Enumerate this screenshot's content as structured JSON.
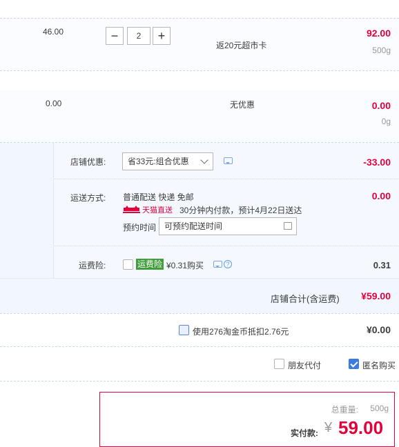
{
  "item1": {
    "unit_price": "46.00",
    "quantity": "2",
    "decrement_symbol": "−",
    "increment_symbol": "+",
    "promo": "返20元超市卡",
    "subtotal": "92.00",
    "weight": "500g"
  },
  "item2": {
    "unit_price": "0.00",
    "promo": "无优惠",
    "subtotal": "0.00",
    "weight": "0g"
  },
  "shop_discount": {
    "label": "店铺优惠:",
    "selected": "省33元:组合优惠",
    "amount": "-33.00"
  },
  "delivery": {
    "label": "运送方式:",
    "method": "普通配送 快递 免邮",
    "brand_tag": "天猫直送",
    "promise": "30分钟内付款，预计4月22日送达",
    "time_label": "预约时间",
    "time_placeholder": "可预约配送时间",
    "fee": "0.00"
  },
  "insurance": {
    "label": "运费险:",
    "tag": "运费险",
    "text": "¥0.31购买",
    "amount": "0.31",
    "help": "?"
  },
  "shop_total": {
    "label": "店铺合计(含运费)",
    "amount": "¥59.00"
  },
  "taojinbi": {
    "text": "使用276淘金币抵扣2.76元",
    "amount": "¥0.00"
  },
  "options": {
    "friend_pay": "朋友代付",
    "anonymous": "匿名购买"
  },
  "summary": {
    "weight_label": "总重量:",
    "weight": "500g",
    "pay_label": "实付款:",
    "currency": "¥",
    "amount": "59.00"
  },
  "colors": {
    "price_red": "#e4003a",
    "link_blue": "#3b7ce0",
    "tag_green": "#3f9d3a",
    "section_bg": "#f2f7ff"
  }
}
